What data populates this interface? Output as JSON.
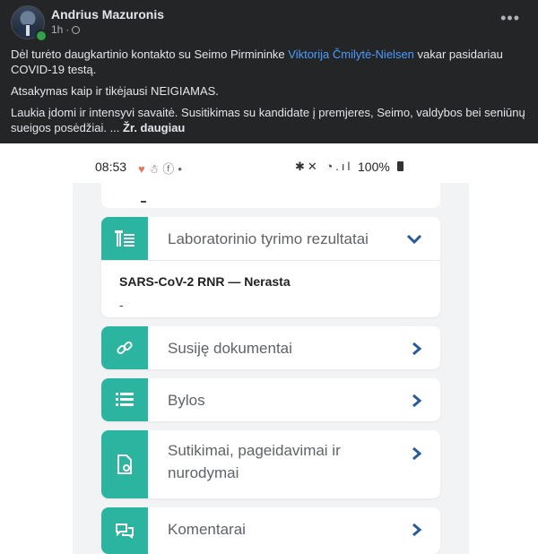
{
  "post": {
    "author": "Andrius Mazuronis",
    "time": "1h",
    "paragraph1_before": "Dėl turėto daugkartinio kontakto su Seimo Pirmininke ",
    "paragraph1_link": "Viktorija Čmilytė-Nielsen",
    "paragraph1_after": " vakar pasidariau COVID-19 testą.",
    "paragraph2": "Atsakymas kaip ir tikėjausi NEIGIAMAS.",
    "paragraph3": "Laukia įdomi ir intensyvi savaitė. Susitikimas su kandidate į premjeres, Seimo, valdybos bei seniūnų sueigos posėdžiai. ...",
    "see_more": "Žr. daugiau",
    "more_icon": "more-options-icon"
  },
  "phone": {
    "status_time": "08:53",
    "battery": "100%",
    "lab_results": {
      "label": "Laboratorinio tyrimo rezultatai",
      "result": "SARS-CoV-2 RNR — Nerasta",
      "detail": "-"
    },
    "items": {
      "docs": "Susiję dokumentai",
      "files": "Bylos",
      "consents": "Sutikimai, pageidavimai ir nurodymai",
      "comments": "Komentarai"
    }
  },
  "colors": {
    "accent": "#2bb5a0",
    "chevron": "#2a5a9e",
    "fb_bg": "#242526",
    "link": "#4b9bff"
  }
}
